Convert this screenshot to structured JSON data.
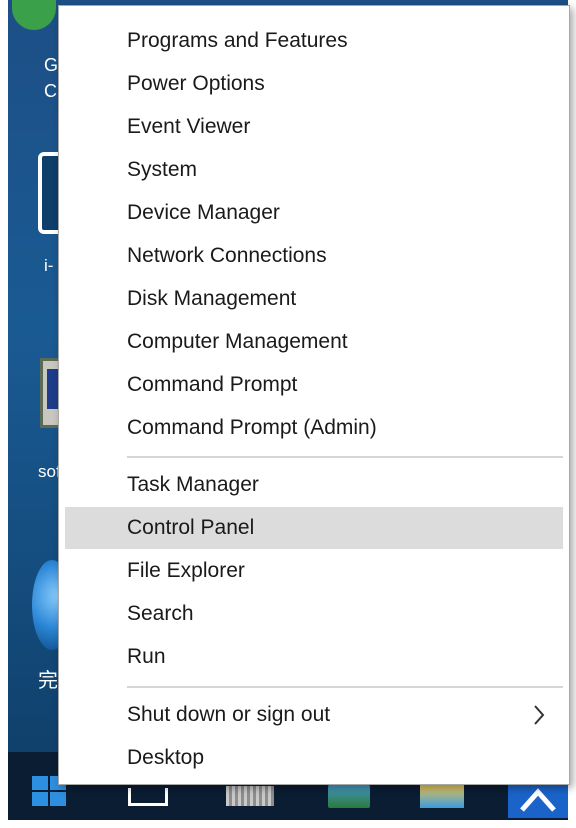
{
  "desktop": {
    "icon_labels": [
      "G\nC",
      "i-",
      "sof",
      "完"
    ]
  },
  "menu": {
    "groups": [
      [
        "Programs and Features",
        "Power Options",
        "Event Viewer",
        "System",
        "Device Manager",
        "Network Connections",
        "Disk Management",
        "Computer Management",
        "Command Prompt",
        "Command Prompt (Admin)"
      ],
      [
        "Task Manager",
        "Control Panel",
        "File Explorer",
        "Search",
        "Run"
      ],
      [
        "Shut down or sign out",
        "Desktop"
      ]
    ],
    "highlighted": "Control Panel",
    "submenu_item": "Shut down or sign out"
  },
  "taskbar": {
    "icons": [
      "windows-logo-icon",
      "task-view-icon",
      "app-icon",
      "app-icon",
      "app-icon",
      "chevron-up-icon"
    ]
  }
}
